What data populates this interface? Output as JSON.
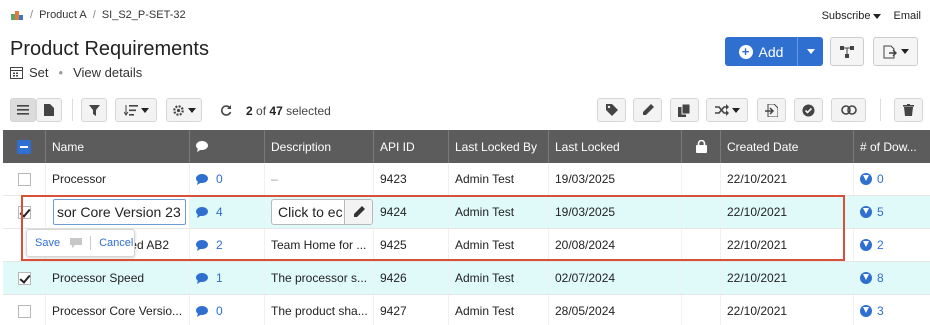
{
  "breadcrumb": {
    "items": [
      "Product A",
      "SI_S2_P-SET-32"
    ]
  },
  "header": {
    "title": "Product Requirements",
    "set_label": "Set",
    "view_details": "View details",
    "subscribe": "Subscribe",
    "email": "Email",
    "add_label": "Add"
  },
  "toolbar": {
    "selected_count": "2",
    "selected_of": "of",
    "total": "47",
    "selected_word": "selected"
  },
  "columns": [
    "Name",
    "Description",
    "API ID",
    "Last Locked By",
    "Last Locked",
    "Created Date",
    "# of Dow..."
  ],
  "editing": {
    "name_value": "sor Core Version 23",
    "desc_value": "Click to ec",
    "save_label": "Save",
    "cancel_label": "Cancel"
  },
  "rows": [
    {
      "name": "Processor",
      "comments": "0",
      "description": "–",
      "api_id": "9423",
      "locked_by": "Admin Test",
      "last_locked": "19/03/2025",
      "created": "22/10/2021",
      "downstream": "0"
    },
    {
      "name": "",
      "comments": "4",
      "description": "",
      "api_id": "9424",
      "locked_by": "Admin Test",
      "last_locked": "19/03/2025",
      "created": "22/10/2021",
      "downstream": "5"
    },
    {
      "name": "ed AB2",
      "comments": "2",
      "description": "Team Home for ...",
      "api_id": "9425",
      "locked_by": "Admin Test",
      "last_locked": "20/08/2024",
      "created": "22/10/2021",
      "downstream": "2"
    },
    {
      "name": "Processor Speed",
      "comments": "1",
      "description": "The processor s...",
      "api_id": "9426",
      "locked_by": "Admin Test",
      "last_locked": "02/07/2024",
      "created": "22/10/2021",
      "downstream": "8"
    },
    {
      "name": "Processor Core Versio...",
      "comments": "0",
      "description": "The product sha...",
      "api_id": "9427",
      "locked_by": "Admin Test",
      "last_locked": "28/05/2024",
      "created": "22/10/2021",
      "downstream": "3"
    }
  ],
  "colors": {
    "accent": "#2f6fd0",
    "header_bg": "#5c5c5c",
    "selected_row": "#e0fafa",
    "highlight": "#d7503a"
  }
}
